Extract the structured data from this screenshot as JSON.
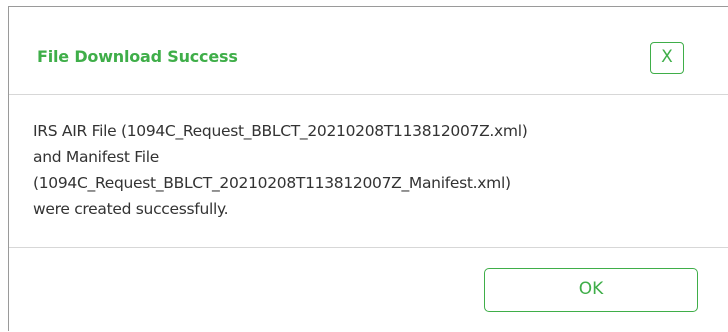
{
  "dialog": {
    "title": "File Download Success",
    "close_label": "X",
    "message_lines": [
      "IRS AIR File (1094C_Request_BBLCT_20210208T113812007Z.xml)",
      "and Manifest File",
      "(1094C_Request_BBLCT_20210208T113812007Z_Manifest.xml)",
      "were created successfully."
    ],
    "ok_label": "OK"
  },
  "colors": {
    "accent": "#3fae49",
    "text": "#333333",
    "divider": "#d7d7d7"
  }
}
